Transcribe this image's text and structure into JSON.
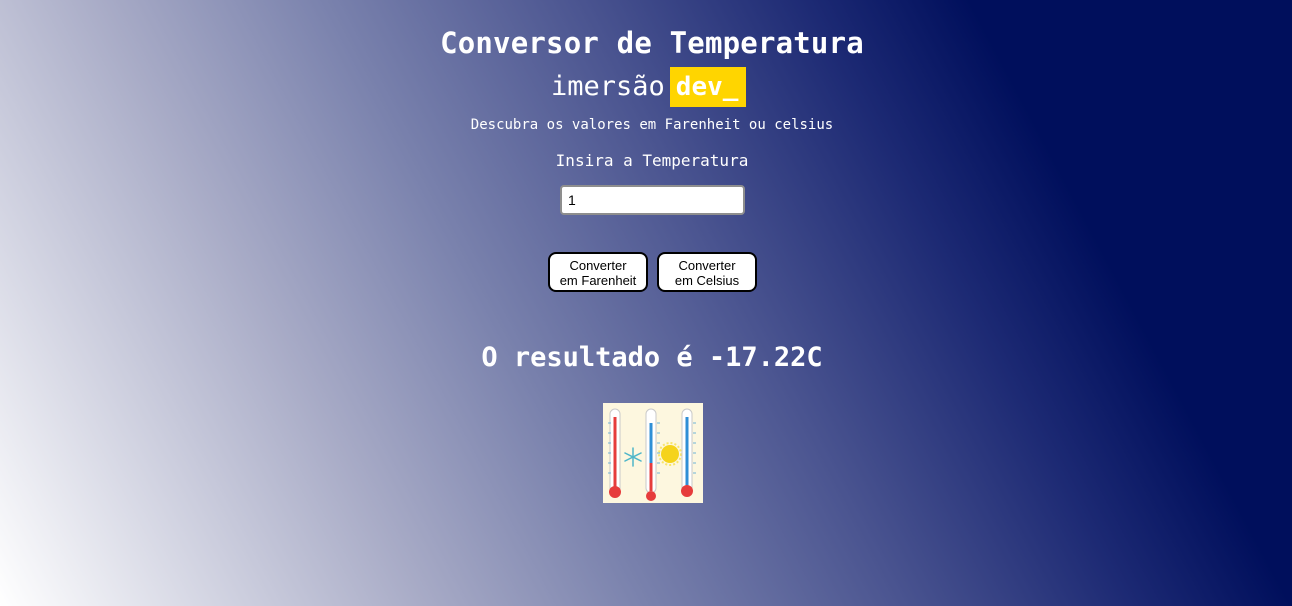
{
  "header": {
    "title": "Conversor de Temperatura",
    "logo_left": "imersão",
    "logo_right": "dev_",
    "subtitle": "Descubra os valores em Farenheit ou celsius"
  },
  "form": {
    "prompt": "Insira a Temperatura",
    "temperature_value": "1",
    "buttons": {
      "farenheit_line1": "Converter",
      "farenheit_line2": "em Farenheit",
      "celsius_line1": "Converter",
      "celsius_line2": "em Celsius"
    }
  },
  "result": {
    "text": "O resultado é -17.22C"
  },
  "image": {
    "icon": "thermometers-icon"
  },
  "colors": {
    "logo_accent": "#ffd500",
    "background_dark": "#000f5c"
  }
}
